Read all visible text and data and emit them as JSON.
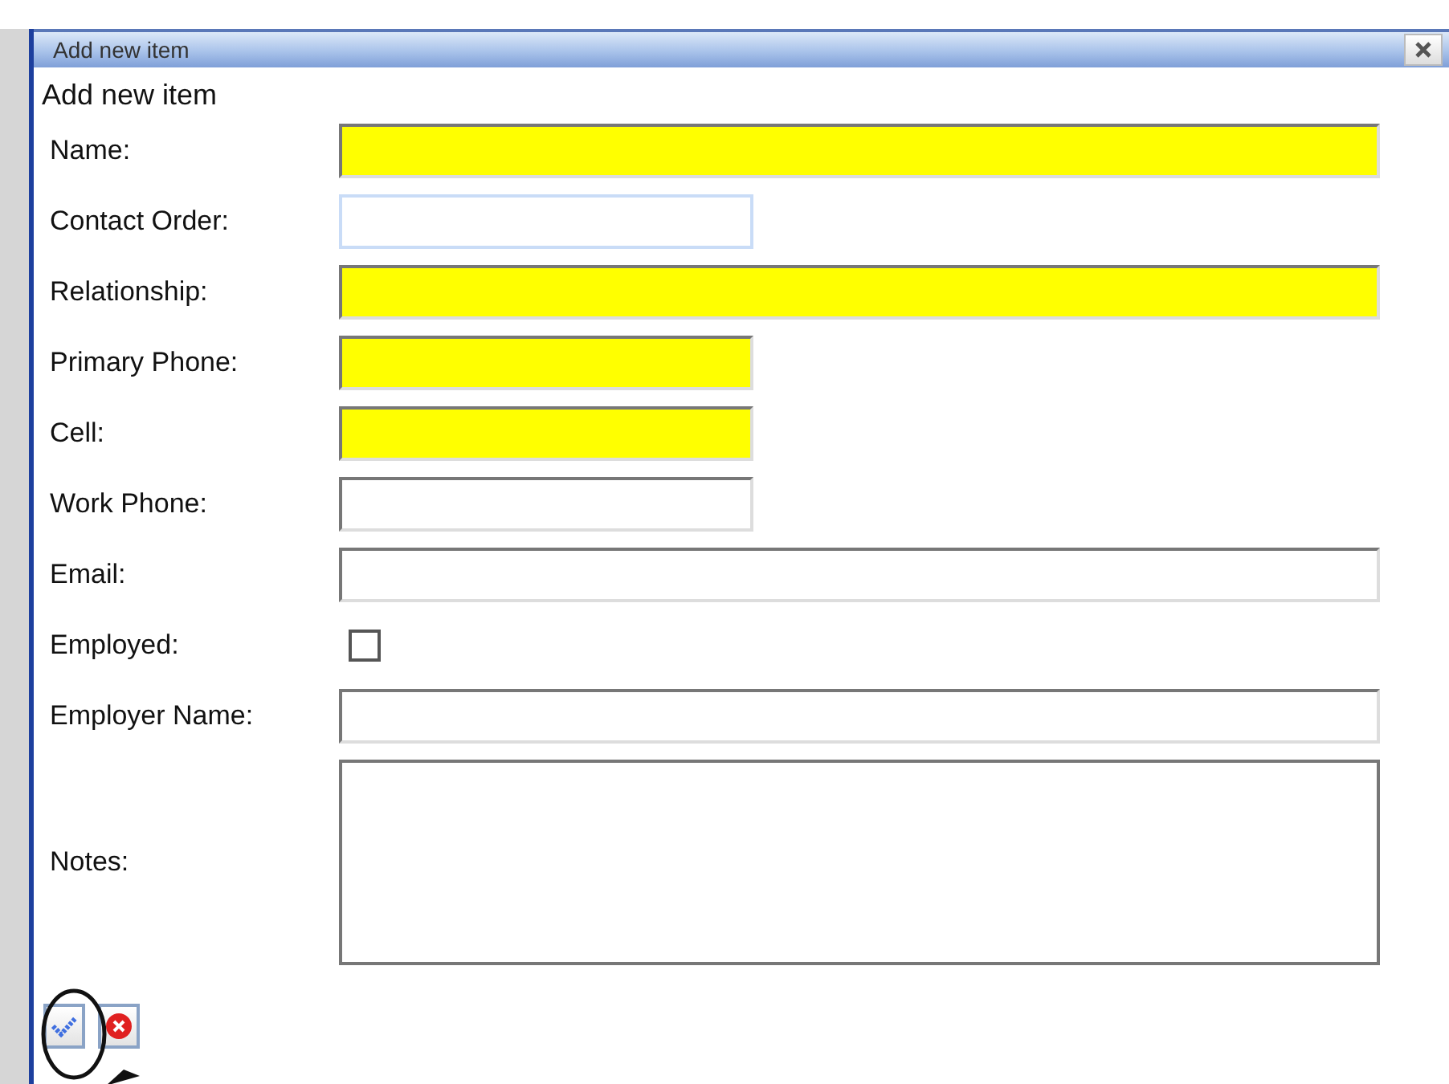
{
  "window": {
    "title": "Add new item"
  },
  "heading": "Add new item",
  "fields": [
    {
      "label": "Name:",
      "kind": "long",
      "required": true,
      "focused": false
    },
    {
      "label": "Contact Order:",
      "kind": "short",
      "required": false,
      "focused": true
    },
    {
      "label": "Relationship:",
      "kind": "long",
      "required": true,
      "focused": false
    },
    {
      "label": "Primary Phone:",
      "kind": "short",
      "required": true,
      "focused": false
    },
    {
      "label": "Cell:",
      "kind": "short",
      "required": true,
      "focused": false
    },
    {
      "label": "Work Phone:",
      "kind": "short",
      "required": false,
      "focused": false
    },
    {
      "label": "Email:",
      "kind": "long",
      "required": false,
      "focused": false
    },
    {
      "label": "Employed:",
      "kind": "checkbox",
      "checked": false
    },
    {
      "label": "Employer Name:",
      "kind": "long",
      "required": false,
      "focused": false
    },
    {
      "label": "Notes:",
      "kind": "textarea",
      "required": false,
      "focused": false
    }
  ]
}
